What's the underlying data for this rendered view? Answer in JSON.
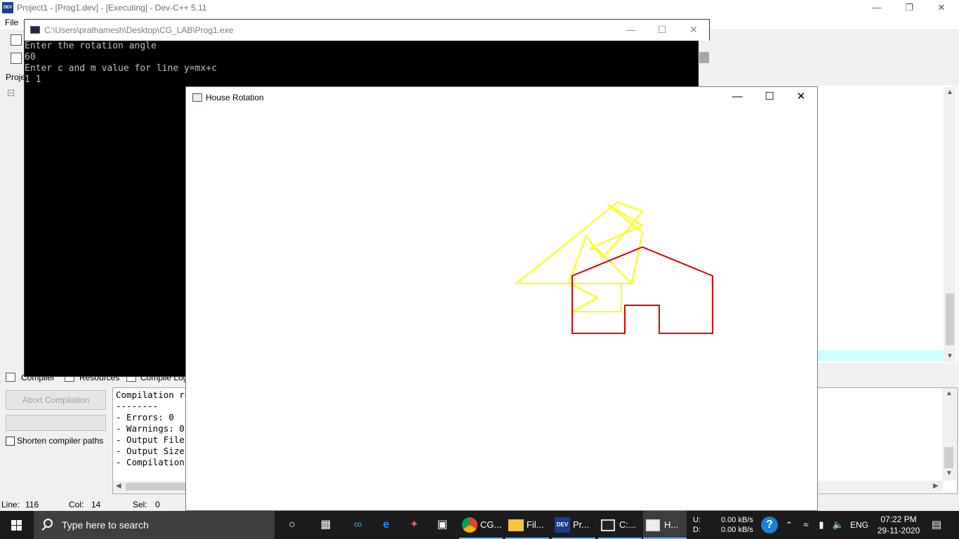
{
  "devcpp": {
    "title": "Project1 - [Prog1.dev] - [Executing] - Dev-C++ 5.11",
    "menu_file": "File",
    "project_tab": "Proje",
    "bottom_tabs": [
      "Compiler",
      "Resources",
      "Compile Log"
    ],
    "abort_label": "Abort Compilation",
    "shorten_label": "Shorten compiler paths",
    "log_lines": [
      "Compilation results...",
      "--------",
      "- Errors: 0",
      "- Warnings: 0",
      "- Output Filename:",
      "- Output Size:",
      "- Compilation Time:"
    ],
    "status": {
      "line_label": "Line:",
      "line_value": "116",
      "col_label": "Col:",
      "col_value": "14",
      "sel_label": "Sel:",
      "sel_value": "0"
    }
  },
  "console": {
    "title": "C:\\Users\\prathamesh\\Desktop\\CG_LAB\\Prog1.exe",
    "lines": [
      "Enter the rotation angle",
      "60",
      "Enter c and m value for line y=mx+c",
      "1 1"
    ]
  },
  "graphics": {
    "title": "House Rotation",
    "original_color": "#e00000",
    "rotated_color": "#ffff00"
  },
  "taskbar": {
    "search_placeholder": "Type here to search",
    "apps": [
      {
        "icon": "chrome-icon",
        "label": "CG..."
      },
      {
        "icon": "file-explorer-icon",
        "label": "Fil..."
      },
      {
        "icon": "devcpp-icon",
        "label": "Pr..."
      },
      {
        "icon": "console-icon",
        "label": "C:..."
      },
      {
        "icon": "window-icon",
        "label": "H..."
      }
    ],
    "net_u_label": "U:",
    "net_d_label": "D:",
    "net_up": "0.00 kB/s",
    "net_down": "0.00 kB/s",
    "language": "ENG",
    "time": "07:22 PM",
    "date": "29-11-2020"
  }
}
